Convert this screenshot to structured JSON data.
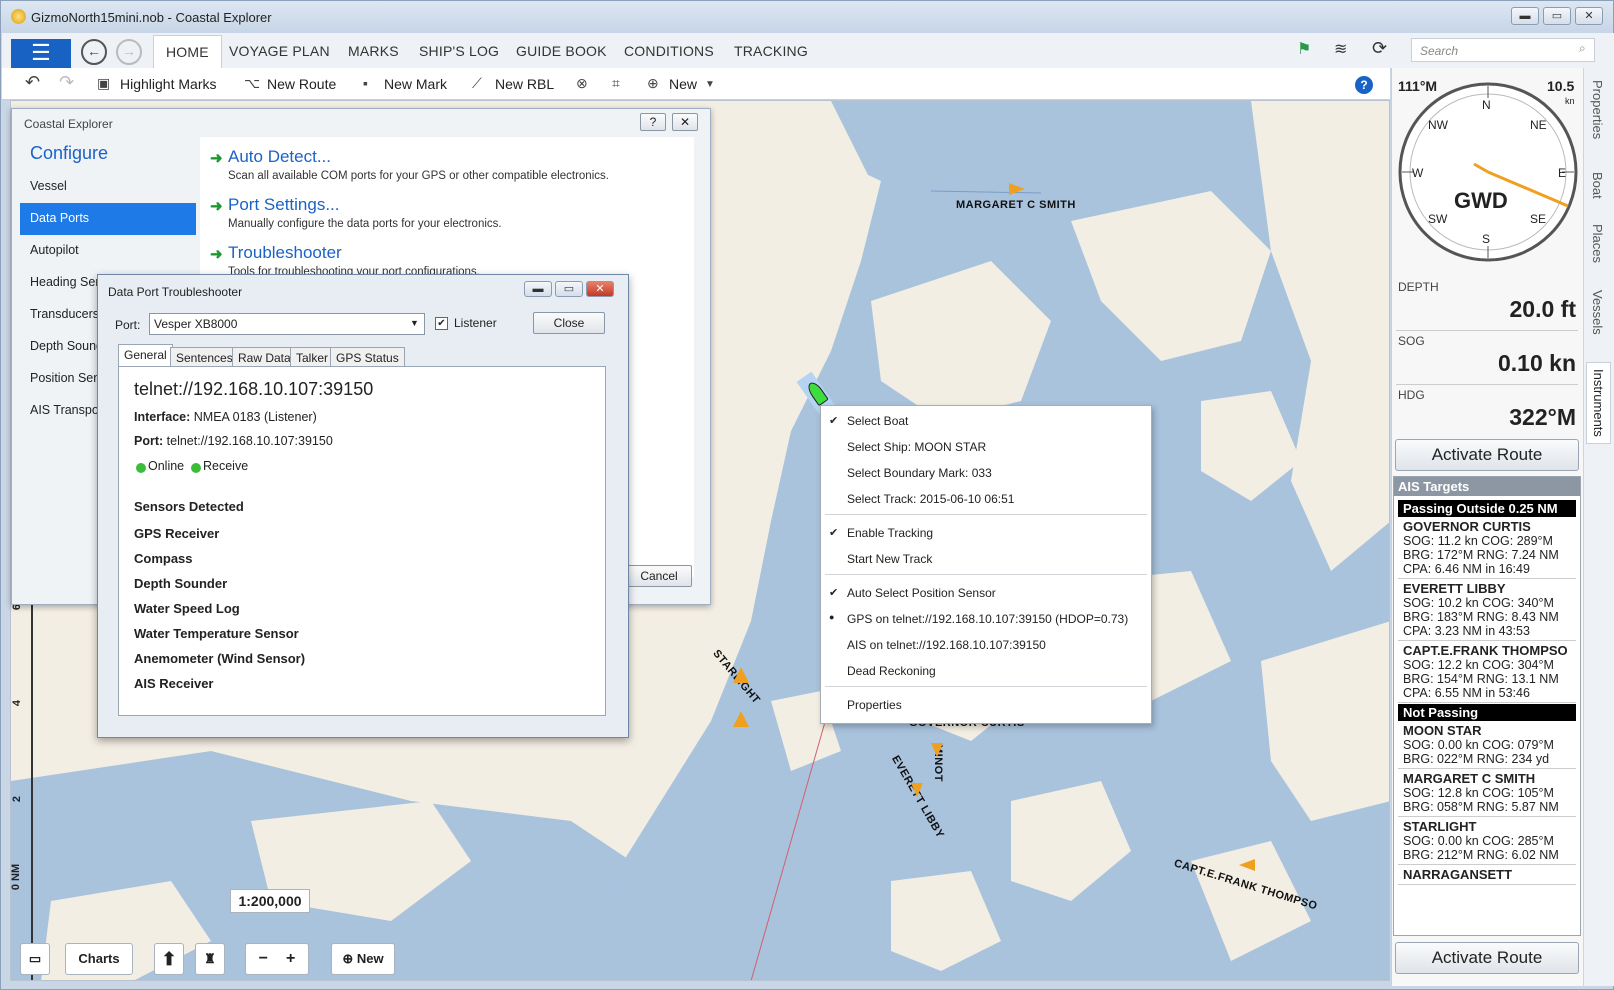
{
  "window": {
    "title": "GizmoNorth15mini.nob - Coastal Explorer",
    "controls": [
      "▬",
      "▭",
      "✕"
    ]
  },
  "nav": {
    "back": "←",
    "forward": "→",
    "tabs": [
      {
        "label": "HOME"
      },
      {
        "label": "VOYAGE PLAN"
      },
      {
        "label": "MARKS"
      },
      {
        "label": "SHIP'S LOG"
      },
      {
        "label": "GUIDE BOOK"
      },
      {
        "label": "CONDITIONS"
      },
      {
        "label": "TRACKING"
      }
    ],
    "search_placeholder": "Search"
  },
  "toolbar": {
    "highlight_marks": "Highlight Marks",
    "new_route": "New Route",
    "new_mark": "New Mark",
    "new_rbl": "New RBL",
    "new": "New",
    "help": "?"
  },
  "instruments": {
    "cog": "111°M",
    "speed": "10.5",
    "speed_unit": "kn",
    "compass_label": "GWD",
    "dirs": {
      "n": "N",
      "ne": "NE",
      "e": "E",
      "se": "SE",
      "s": "S",
      "sw": "SW",
      "w": "W",
      "nw": "NW"
    },
    "depth_label": "DEPTH",
    "depth": "20.0 ft",
    "sog_label": "SOG",
    "sog": "0.10 kn",
    "hdg_label": "HDG",
    "hdg": "322°M",
    "activate_route": "Activate Route"
  },
  "side_tabs": [
    "Properties",
    "Boat",
    "Places",
    "Vessels",
    "Instruments"
  ],
  "ais": {
    "title": "AIS Targets",
    "group1": "Passing Outside 0.25 NM",
    "group1_items": [
      {
        "name": "GOVERNOR CURTIS",
        "l1": "SOG: 11.2 kn  COG: 289°M",
        "l2": "BRG: 172°M  RNG: 7.24 NM",
        "l3": "CPA: 6.46 NM in 16:49"
      },
      {
        "name": "EVERETT LIBBY",
        "l1": "SOG: 10.2 kn  COG: 340°M",
        "l2": "BRG: 183°M  RNG: 8.43 NM",
        "l3": "CPA: 3.23 NM in 43:53"
      },
      {
        "name": "CAPT.E.FRANK THOMPSO",
        "l1": "SOG: 12.2 kn  COG: 304°M",
        "l2": "BRG: 154°M  RNG: 13.1 NM",
        "l3": "CPA: 6.55 NM in 53:46"
      }
    ],
    "group2": "Not Passing",
    "group2_items": [
      {
        "name": "MOON STAR",
        "l1": "SOG: 0.00 kn  COG: 079°M",
        "l2": "BRG: 022°M  RNG: 234 yd"
      },
      {
        "name": "MARGARET C SMITH",
        "l1": "SOG: 12.8 kn  COG: 105°M",
        "l2": "BRG: 058°M  RNG: 5.87 NM"
      },
      {
        "name": "STARLIGHT",
        "l1": "SOG: 0.00 kn  COG: 285°M",
        "l2": "BRG: 212°M  RNG: 6.02 NM"
      },
      {
        "name": "NARRAGANSETT"
      }
    ]
  },
  "configure": {
    "window_title": "Coastal Explorer",
    "heading": "Configure",
    "items": [
      "Vessel",
      "Data Ports",
      "Autopilot",
      "Heading Sen",
      "Transducers",
      "Depth Sound",
      "Position Sens",
      "AIS Transpor"
    ],
    "actions": [
      {
        "title": "Auto Detect...",
        "desc": "Scan all available COM ports for your GPS or other compatible electronics."
      },
      {
        "title": "Port Settings...",
        "desc": "Manually configure the data ports for your electronics."
      },
      {
        "title": "Troubleshooter",
        "desc": "Tools for troubleshooting your port configurations."
      }
    ],
    "cancel": "Cancel",
    "help_btn": "?",
    "close_btn": "✕"
  },
  "troubleshooter": {
    "title": "Data Port Troubleshooter",
    "port_label": "Port:",
    "port_value": "Vesper XB8000",
    "listener": "Listener",
    "close": "Close",
    "tabs": [
      "General",
      "Sentences",
      "Raw Data",
      "Talker",
      "GPS Status"
    ],
    "url": "telnet://192.168.10.107:39150",
    "interface_label": "Interface:",
    "interface_value": "NMEA 0183 (Listener)",
    "port_row_label": "Port:",
    "port_row_value": "telnet://192.168.10.107:39150",
    "online": "Online",
    "receive": "Receive",
    "sensors_heading": "Sensors Detected",
    "sensors": [
      "GPS Receiver",
      "Compass",
      "Depth Sounder",
      "Water Speed Log",
      "Water Temperature Sensor",
      "Anemometer (Wind Sensor)",
      "AIS Receiver"
    ]
  },
  "context_menu": {
    "items": [
      "Select Boat",
      "Select Ship: MOON STAR",
      "Select Boundary Mark: 033",
      "Select Track: 2015-06-10 06:51",
      "Enable Tracking",
      "Start New Track",
      "Auto Select Position Sensor",
      "GPS on telnet://192.168.10.107:39150 (HDOP=0.73)",
      "AIS on telnet://192.168.10.107:39150",
      "Dead Reckoning",
      "Properties"
    ],
    "check": "✔",
    "bullet": "●"
  },
  "map": {
    "vessels": [
      "MARGARET C SMITH",
      "STARLIGHT",
      "GOVERNOR CURTIS",
      "MINOT",
      "EVERETT LIBBY",
      "CAPT.E.FRANK THOMPSO"
    ],
    "scale_labels": [
      "6",
      "4",
      "2",
      "0 NM"
    ],
    "scale": "1:200,000",
    "charts": "Charts",
    "zoom_out": "−",
    "zoom_in": "+",
    "new": "New"
  }
}
